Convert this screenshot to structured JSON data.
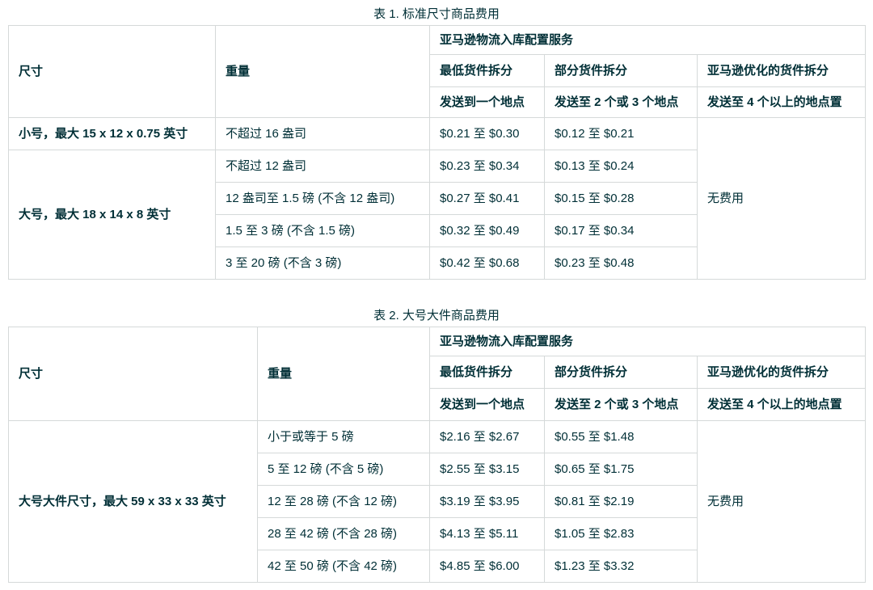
{
  "page": {
    "background": "#ffffff",
    "text_color": "#002f36",
    "border_color": "#d5d9d9"
  },
  "table1": {
    "title": "表 1. 标准尺寸商品费用",
    "header": {
      "size": "尺寸",
      "weight": "重量",
      "service": "亚马逊物流入库配置服务",
      "min_split": "最低货件拆分",
      "partial_split": "部分货件拆分",
      "optimized_split": "亚马逊优化的货件拆分",
      "min_sub": "发送到一个地点",
      "partial_sub": "发送至 2 个或 3 个地点",
      "optimized_sub": "发送至 4 个以上的地点置"
    },
    "rows": [
      {
        "size": "小号，最大 15 x 12 x 0.75 英寸",
        "weight": "不超过 16 盎司",
        "min": "$0.21 至 $0.30",
        "partial": "$0.12 至 $0.21"
      },
      {
        "size": "大号，最大 18 x 14 x 8 英寸",
        "weight": "不超过 12 盎司",
        "min": "$0.23 至 $0.34",
        "partial": "$0.13 至 $0.24"
      },
      {
        "weight": "12 盎司至 1.5 磅 (不含 12 盎司)",
        "min": "$0.27 至 $0.41",
        "partial": "$0.15 至 $0.28"
      },
      {
        "weight": "1.5 至 3 磅 (不含 1.5 磅)",
        "min": "$0.32 至 $0.49",
        "partial": "$0.17 至 $0.34"
      },
      {
        "weight": "3 至 20 磅 (不含 3 磅)",
        "min": "$0.42 至 $0.68",
        "partial": "$0.23 至 $0.48"
      }
    ],
    "no_fee": "无费用"
  },
  "table2": {
    "title": "表 2. 大号大件商品费用",
    "header": {
      "size": "尺寸",
      "weight": "重量",
      "service": "亚马逊物流入库配置服务",
      "min_split": "最低货件拆分",
      "partial_split": "部分货件拆分",
      "optimized_split": "亚马逊优化的货件拆分",
      "min_sub": "发送到一个地点",
      "partial_sub": "发送至 2 个或 3 个地点",
      "optimized_sub": "发送至 4 个以上的地点置"
    },
    "rows": [
      {
        "size": "大号大件尺寸，最大 59 x 33 x 33 英寸",
        "weight": "小于或等于 5 磅",
        "min": "$2.16 至 $2.67",
        "partial": "$0.55 至 $1.48"
      },
      {
        "weight": "5 至 12 磅 (不含 5 磅)",
        "min": "$2.55 至 $3.15",
        "partial": "$0.65 至 $1.75"
      },
      {
        "weight": "12 至 28 磅 (不含 12 磅)",
        "min": "$3.19 至 $3.95",
        "partial": "$0.81 至 $2.19"
      },
      {
        "weight": "28 至 42 磅 (不含 28 磅)",
        "min": "$4.13 至 $5.11",
        "partial": "$1.05 至 $2.83"
      },
      {
        "weight": "42 至 50 磅 (不含 42 磅)",
        "min": "$4.85 至 $6.00",
        "partial": "$1.23 至 $3.32"
      }
    ],
    "no_fee": "无费用"
  }
}
